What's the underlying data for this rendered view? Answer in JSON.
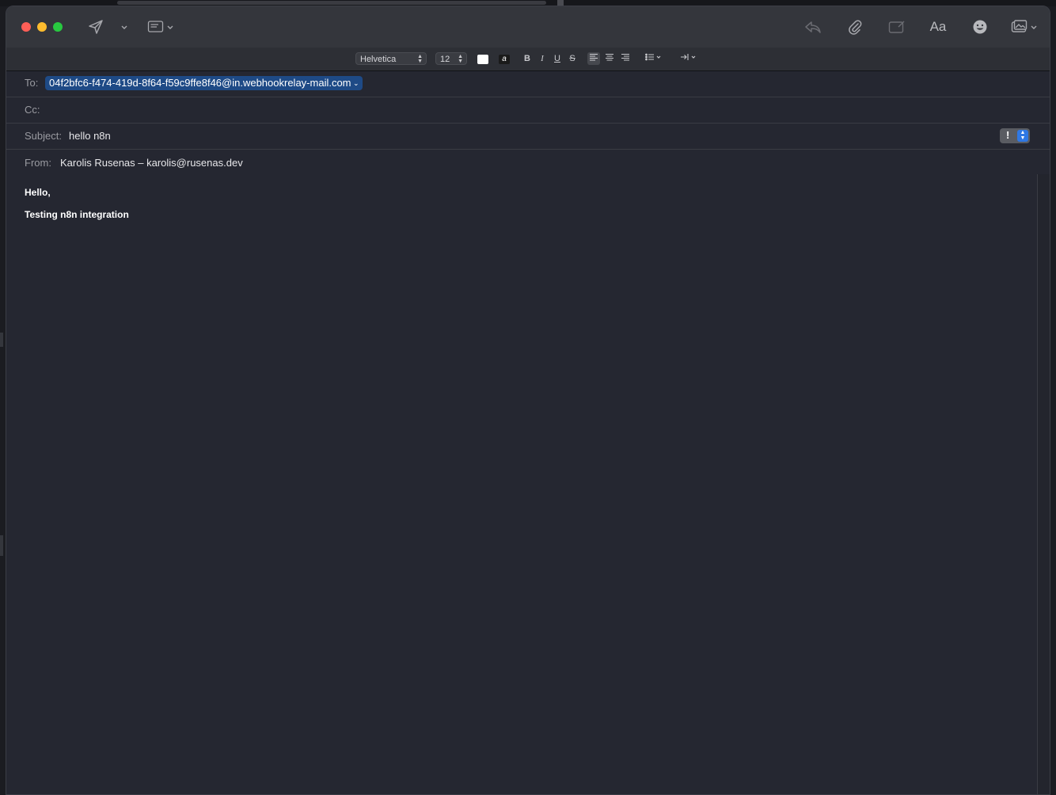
{
  "formatting": {
    "font_family": "Helvetica",
    "font_size": "12",
    "bold": "B",
    "italic": "I",
    "underline": "U",
    "strikethrough": "S"
  },
  "headers": {
    "to_label": "To:",
    "to_recipient": "04f2bfc6-f474-419d-8f64-f59c9ffe8f46@in.webhookrelay-mail.com",
    "cc_label": "Cc:",
    "subject_label": "Subject:",
    "subject_value": "hello n8n",
    "from_label": "From:",
    "from_value": "Karolis Rusenas – karolis@rusenas.dev",
    "priority_symbol": "!"
  },
  "toolbar": {
    "font_panel_label": "Aa"
  },
  "body": {
    "lines": [
      "Hello,",
      "Testing n8n integration"
    ]
  },
  "icons": {
    "send": "send-icon",
    "header_fields": "header-fields-icon",
    "reply": "reply-icon",
    "attach": "paperclip-icon",
    "markup": "markup-icon",
    "emoji": "emoji-icon",
    "photo_browser": "photo-browser-icon"
  },
  "colors": {
    "window_bg": "#252731",
    "toolbar_bg": "#34363c",
    "recipient_token": "#1e4a86",
    "priority_stepper": "#2f78e4"
  }
}
